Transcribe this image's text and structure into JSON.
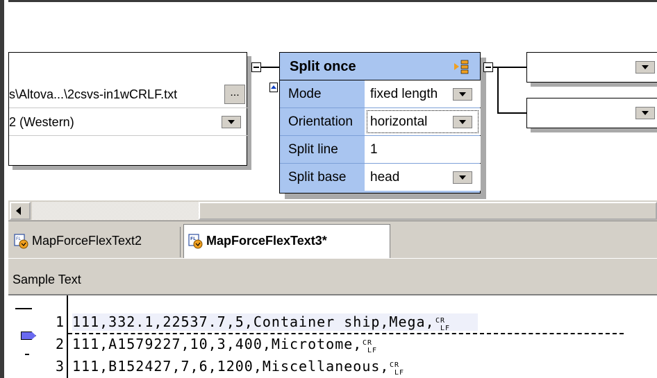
{
  "source_component": {
    "path_value": "s\\Altova...\\2csvs-in1wCRLF.txt",
    "browse_label": "...",
    "encoding_value": "2 (Western)"
  },
  "split_component": {
    "title": "Split once",
    "rows": [
      {
        "label": "Mode",
        "value": "fixed length",
        "has_dropdown": true
      },
      {
        "label": "Orientation",
        "value": "horizontal",
        "has_dropdown": true
      },
      {
        "label": "Split line",
        "value": "1",
        "has_dropdown": false
      },
      {
        "label": "Split base",
        "value": "head",
        "has_dropdown": true
      }
    ]
  },
  "tabs": [
    {
      "label": "MapForceFlexText2",
      "active": false
    },
    {
      "label": "MapForceFlexText3*",
      "active": true
    }
  ],
  "sample_text": {
    "header": "Sample Text",
    "lines": [
      {
        "num": "1",
        "text": "111,332.1,22537.7,5,Container ship,Mega,"
      },
      {
        "num": "2",
        "text": "111,A1579227,10,3,400,Microtome,"
      },
      {
        "num": "3",
        "text": "111,B152427,7,6,1200,Miscellaneous,"
      }
    ]
  },
  "colors": {
    "component_header": "#a9c5f0",
    "marker": "#6a6af0",
    "accent_icon": "#f0a020"
  },
  "icons": {
    "split": "split-component-icon",
    "tab": "flextext-file-icon",
    "crlf": "crlf-icon"
  }
}
